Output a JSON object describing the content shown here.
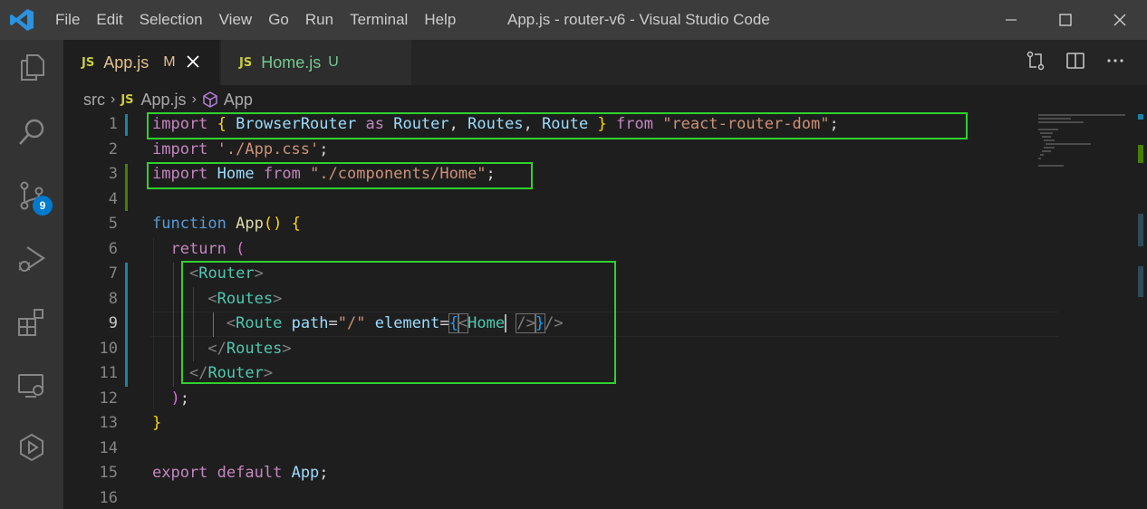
{
  "window": {
    "title": "App.js - router-v6 - Visual Studio Code",
    "menu": [
      "File",
      "Edit",
      "Selection",
      "View",
      "Go",
      "Run",
      "Terminal",
      "Help"
    ]
  },
  "activity_bar": {
    "items": [
      "explorer-icon",
      "search-icon",
      "source-control-icon",
      "run-debug-icon",
      "extensions-icon",
      "remote-explorer-icon",
      "live-share-icon"
    ],
    "source_control_badge": "9"
  },
  "tabs": [
    {
      "lang": "JS",
      "name": "App.js",
      "status": "M",
      "active": true
    },
    {
      "lang": "JS",
      "name": "Home.js",
      "status": "U",
      "active": false
    }
  ],
  "breadcrumb": {
    "folder": "src",
    "file_lang": "JS",
    "file": "App.js",
    "symbol": "App"
  },
  "editor": {
    "line_numbers": [
      "1",
      "2",
      "3",
      "4",
      "5",
      "6",
      "7",
      "8",
      "9",
      "10",
      "11",
      "12",
      "13",
      "14",
      "15",
      "16"
    ],
    "current_line": "9",
    "tokens": {
      "import": "import",
      "from": "from",
      "as": "as",
      "browser_router": "BrowserRouter",
      "router": "Router",
      "routes": "Routes",
      "route": "Route",
      "home": "Home",
      "app_css": "'./App.css'",
      "rrd": "\"react-router-dom\"",
      "home_path": "\"./components/Home\"",
      "function": "function",
      "app": "App",
      "return": "return",
      "path": "path",
      "slash": "\"/\"",
      "element": "element",
      "export": "export",
      "default": "default"
    }
  },
  "colors": {
    "highlight_box": "#2fd12f",
    "status_modified": "#e2c08d",
    "status_untracked": "#73c991",
    "accent": "#007acc"
  }
}
